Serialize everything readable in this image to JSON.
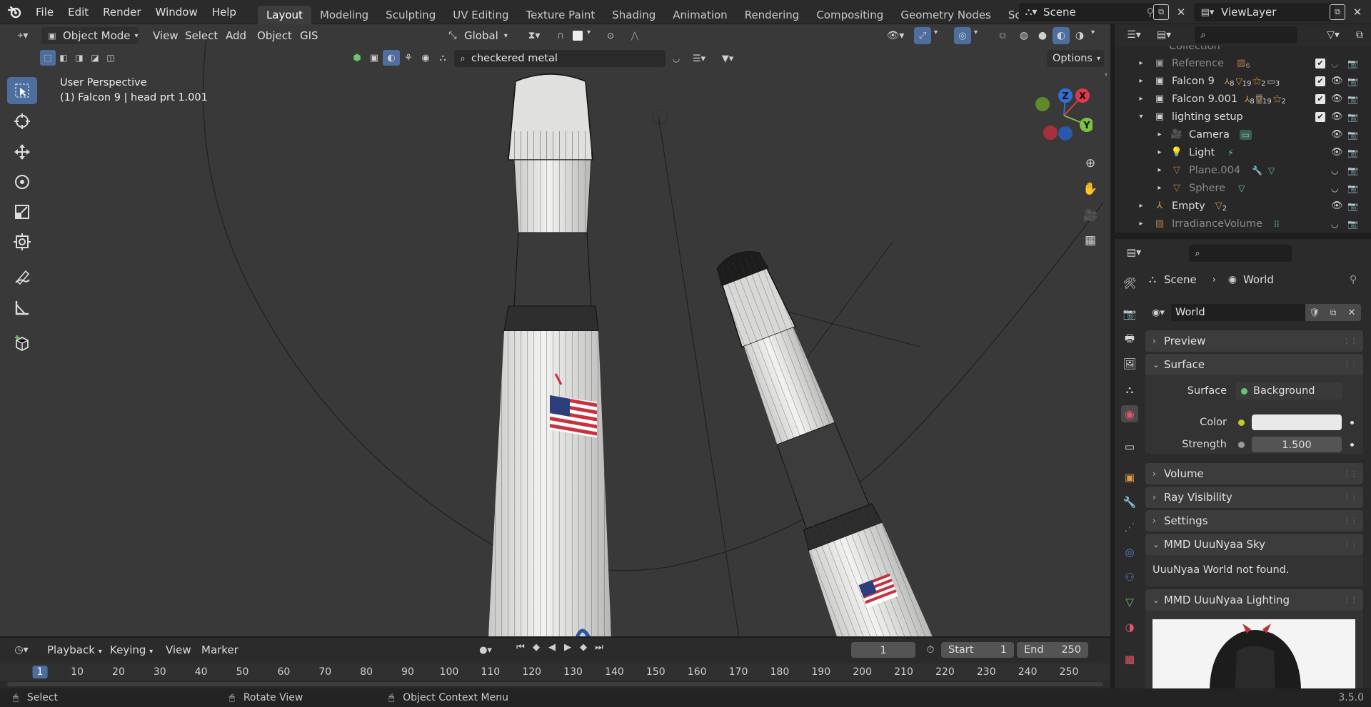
{
  "topbar": {
    "menus": [
      "File",
      "Edit",
      "Render",
      "Window",
      "Help"
    ],
    "workspaces": [
      "Layout",
      "Modeling",
      "Sculpting",
      "UV Editing",
      "Texture Paint",
      "Shading",
      "Animation",
      "Rendering",
      "Compositing",
      "Geometry Nodes",
      "Scripting"
    ],
    "active_workspace": "Layout",
    "scene_label": "Scene",
    "view_layer_label": "ViewLayer"
  },
  "viewport_header": {
    "mode": "Object Mode",
    "menus": [
      "View",
      "Select",
      "Add",
      "Object",
      "GIS"
    ],
    "transform_orientation": "Global",
    "search_value": "checkered metal",
    "options_label": "Options"
  },
  "viewport": {
    "perspective_label": "User Perspective",
    "object_label": "(1) Falcon 9 | head prt 1.001",
    "gizmo_axes": [
      "Z",
      "X",
      "Y"
    ]
  },
  "outliner": {
    "rows": [
      {
        "label": "Collection",
        "indent": 0,
        "dim": true
      },
      {
        "label": "Reference",
        "indent": 0,
        "dim": true,
        "badge": "6"
      },
      {
        "label": "Falcon 9",
        "indent": 0,
        "dim": false,
        "badges": [
          "8",
          "19",
          "2",
          "3"
        ]
      },
      {
        "label": "Falcon 9.001",
        "indent": 0,
        "dim": false,
        "badges": [
          "8",
          "19",
          "2"
        ]
      },
      {
        "label": "lighting setup",
        "indent": 0,
        "dim": false,
        "expanded": true
      },
      {
        "label": "Camera",
        "indent": 1,
        "dim": false
      },
      {
        "label": "Light",
        "indent": 1,
        "dim": false
      },
      {
        "label": "Plane.004",
        "indent": 1,
        "dim": true
      },
      {
        "label": "Sphere",
        "indent": 1,
        "dim": true
      },
      {
        "label": "Empty",
        "indent": 0,
        "dim": false,
        "badge": "2"
      },
      {
        "label": "IrradianceVolume",
        "indent": 0,
        "dim": true
      }
    ]
  },
  "properties": {
    "breadcrumb_scene": "Scene",
    "breadcrumb_world": "World",
    "world_name": "World",
    "panels": {
      "preview": "Preview",
      "surface": "Surface",
      "surface_field_label": "Surface",
      "surface_value": "Background",
      "color_label": "Color",
      "strength_label": "Strength",
      "strength_value": "1.500",
      "volume": "Volume",
      "ray_visibility": "Ray Visibility",
      "settings": "Settings",
      "mmd_sky": "MMD UuuNyaa Sky",
      "mmd_sky_msg": "UuuNyaa World not found.",
      "mmd_lighting": "MMD UuuNyaa Lighting"
    }
  },
  "timeline": {
    "menus": [
      "Playback",
      "Keying",
      "View",
      "Marker"
    ],
    "current_frame": "1",
    "start_label": "Start",
    "start_value": "1",
    "end_label": "End",
    "end_value": "250",
    "ticks": [
      "1",
      "10",
      "20",
      "30",
      "40",
      "50",
      "60",
      "70",
      "80",
      "90",
      "100",
      "110",
      "120",
      "130",
      "140",
      "150",
      "160",
      "170",
      "180",
      "190",
      "200",
      "210",
      "220",
      "230",
      "240",
      "250"
    ]
  },
  "statusbar": {
    "select": "Select",
    "rotate": "Rotate View",
    "context": "Object Context Menu",
    "version": "3.5.0"
  },
  "colors": {
    "accent": "#4d6e9e",
    "viewport_bg": "#393939",
    "panel_bg": "#2b2b2b"
  }
}
